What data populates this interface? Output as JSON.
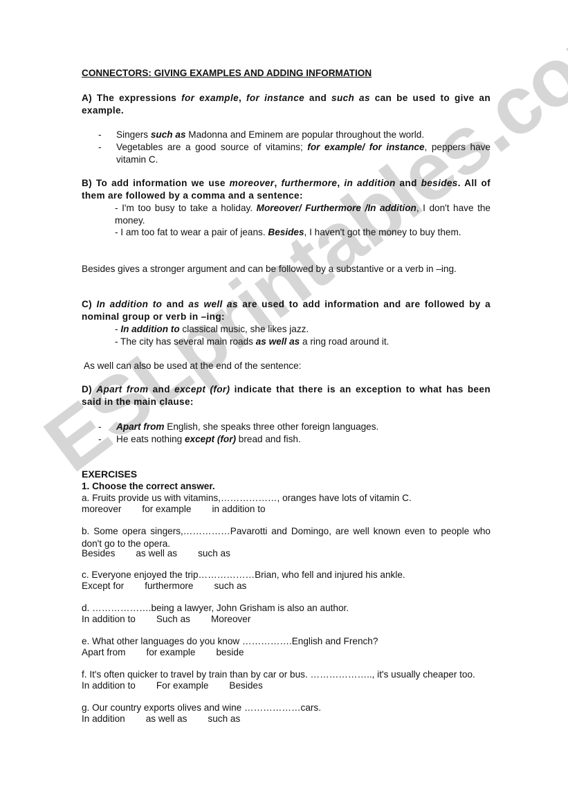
{
  "watermark": "ESLprintables.com",
  "title": "CONNECTORS: GIVING EXAMPLES AND ADDING INFORMATION",
  "sectionA": {
    "heading_parts": [
      "A) The expressions ",
      "for example",
      ", ",
      "for instance",
      " and ",
      "such as",
      " can be used to give an example."
    ],
    "items": [
      {
        "dash": "-",
        "pre": "Singers ",
        "bold": "such as",
        "post": " Madonna and Eminem are popular throughout the world."
      },
      {
        "dash": "-",
        "pre": "Vegetables are a good source of vitamins; ",
        "bold": "for example/ for instance",
        "post": ", peppers have vitamin C."
      }
    ]
  },
  "sectionB": {
    "heading_parts": [
      "B) To add information we use ",
      "moreover",
      ", ",
      "furthermore",
      ", ",
      "in addition",
      " and ",
      "besides",
      ". All of them are followed by a comma and a sentence:"
    ],
    "items": [
      {
        "pre": "- I'm too busy to take a holiday. ",
        "bold": "Moreover/ Furthermore /In addition",
        "post": ", I   don't have the money."
      },
      {
        "pre": "- I am too fat to wear a pair of jeans. ",
        "bold": "Besides",
        "post": ", I haven't got the money to buy them."
      }
    ],
    "note": "Besides gives a stronger argument and can be followed by a substantive or a verb in –ing."
  },
  "sectionC": {
    "heading_parts": [
      "C) ",
      "In addition to",
      " and ",
      "as well as",
      " are used to add information and are followed by a nominal group or verb in –ing:"
    ],
    "items": [
      {
        "pre": "- ",
        "bold": "In addition to",
        "post": " classical music, she likes jazz."
      },
      {
        "pre": "- The city has several main roads ",
        "bold": "as well as",
        "post": " a ring road around it."
      }
    ],
    "note": " As well can also be used at the end of the sentence:"
  },
  "sectionD": {
    "heading_parts": [
      "D) ",
      "Apart from",
      " and ",
      "except (for)",
      " indicate that there is an exception to what has been said in the main clause:"
    ],
    "items": [
      {
        "dash": "-",
        "pre": "",
        "bold": "Apart from",
        "post": " English, she speaks three other foreign languages."
      },
      {
        "dash": "-",
        "pre": "He eats nothing ",
        "bold": "except (for)",
        "post": " bread and fish."
      }
    ]
  },
  "exercises": {
    "heading": "EXERCISES",
    "instruction": "1. Choose the correct answer.",
    "questions": [
      {
        "text": "a. Fruits provide us with vitamins,………………, oranges have lots of vitamin C.",
        "options": [
          "moreover",
          "for example",
          "in addition to"
        ]
      },
      {
        "text": "b. Some opera singers,……………Pavarotti and Domingo, are well known even to people who don't go to the opera.",
        "options": [
          "Besides",
          "as well as",
          "such as"
        ]
      },
      {
        "text": "c. Everyone enjoyed the trip………………Brian, who fell and injured his ankle.",
        "options": [
          "Except for",
          "furthermore",
          "such as"
        ]
      },
      {
        "text": "d. ……………….being a lawyer, John Grisham is also an author.",
        "options": [
          "In addition to",
          "Such as",
          "Moreover"
        ]
      },
      {
        "text": "e. What other languages do you know …………….English and French?",
        "options": [
          "Apart from",
          "for example",
          "beside"
        ]
      },
      {
        "text": "f. It's often quicker to travel by train than by car or bus. ……………….., it's usually cheaper too.",
        "options": [
          "In addition to",
          "For example",
          "Besides"
        ]
      },
      {
        "text": "g. Our country exports olives and wine ………………cars.",
        "options": [
          "In addition",
          "as well as",
          "such as"
        ]
      }
    ]
  }
}
